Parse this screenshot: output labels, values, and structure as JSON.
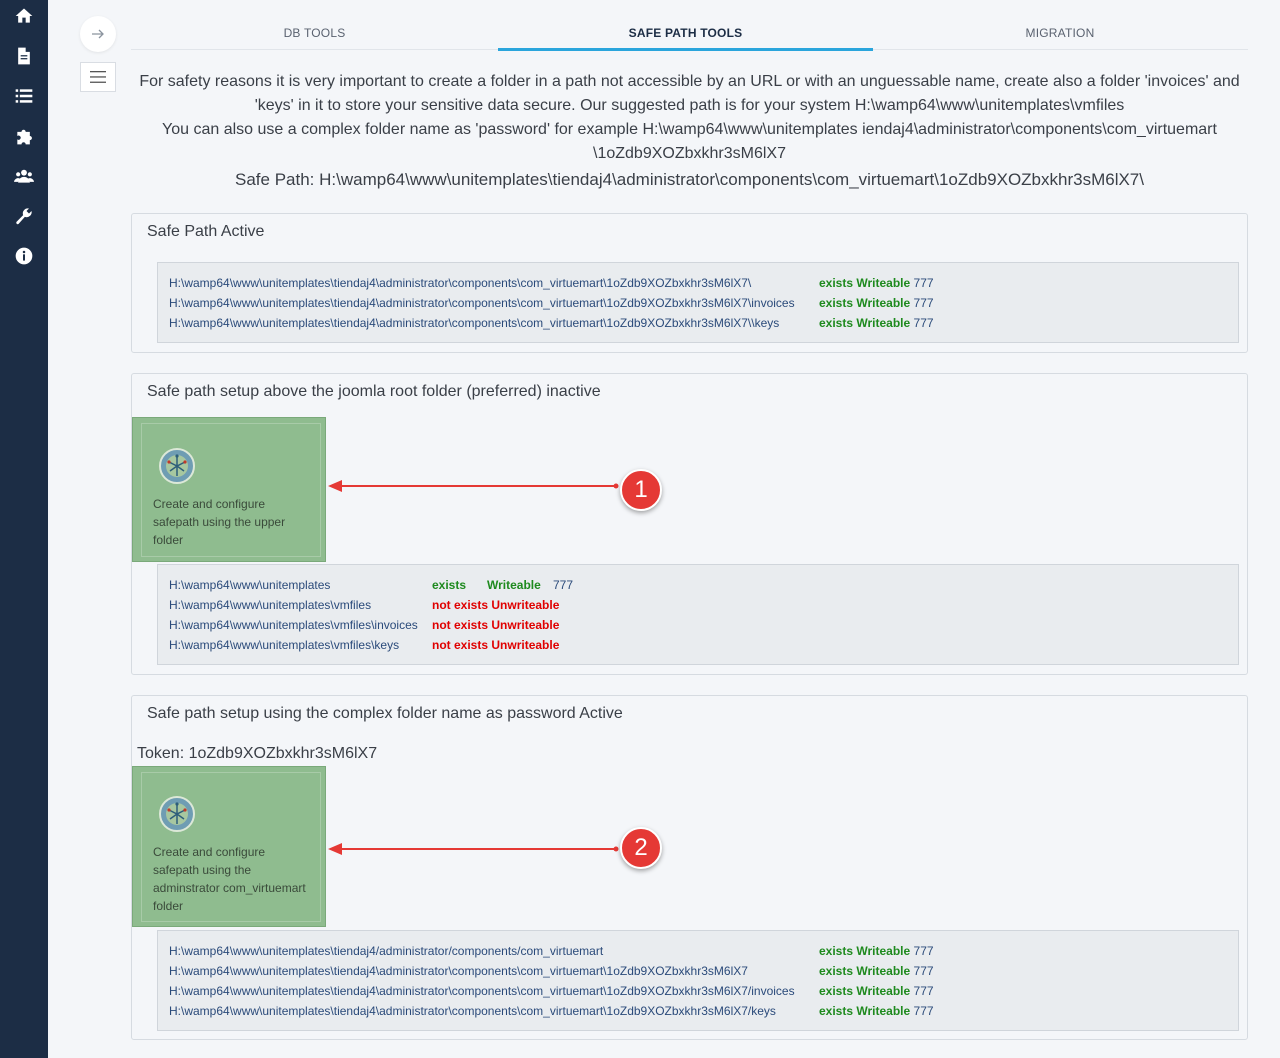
{
  "sidebar": {
    "icons": [
      "home-icon",
      "file-icon",
      "list-icon",
      "puzzle-icon",
      "users-icon",
      "wrench-icon",
      "info-icon"
    ]
  },
  "tabs": [
    {
      "label": "DB TOOLS"
    },
    {
      "label": "SAFE PATH TOOLS"
    },
    {
      "label": "MIGRATION"
    }
  ],
  "intro": {
    "line1": "For safety reasons it is very important to create a folder in a path not accessible by an URL or with an unguessable name, create also a folder 'invoices' and 'keys' in it to store your sensitive data secure. Our suggested path is for your system H:\\wamp64\\www\\unitemplates\\vmfiles",
    "line2": "You can also use a complex folder name as 'password' for example H:\\wamp64\\www\\unitemplates iendaj4\\administrator\\components\\com_virtuemart \\1oZdb9XOZbxkhr3sM6lX7",
    "safe_path": "Safe Path: H:\\wamp64\\www\\unitemplates\\tiendaj4\\administrator\\components\\com_virtuemart\\1oZdb9XOZbxkhr3sM6lX7\\"
  },
  "panel1": {
    "title": "Safe Path Active",
    "rows": [
      {
        "path": "H:\\wamp64\\www\\unitemplates\\tiendaj4\\administrator\\components\\com_virtuemart\\1oZdb9XOZbxkhr3sM6lX7\\",
        "exists": "exists",
        "writeable": "Writeable",
        "perm": "777"
      },
      {
        "path": "H:\\wamp64\\www\\unitemplates\\tiendaj4\\administrator\\components\\com_virtuemart\\1oZdb9XOZbxkhr3sM6lX7\\invoices",
        "exists": "exists",
        "writeable": "Writeable",
        "perm": "777"
      },
      {
        "path": "H:\\wamp64\\www\\unitemplates\\tiendaj4\\administrator\\components\\com_virtuemart\\1oZdb9XOZbxkhr3sM6lX7\\\\keys",
        "exists": "exists",
        "writeable": "Writeable",
        "perm": "777"
      }
    ]
  },
  "panel2": {
    "title": "Safe path setup above the joomla root folder (preferred) inactive",
    "card_text": "Create and configure safepath using the upper folder",
    "callout": "1",
    "rows": [
      {
        "path": "H:\\wamp64\\www\\unitemplates",
        "exists": "exists",
        "writeable": "Writeable",
        "perm": "777"
      },
      {
        "path": "H:\\wamp64\\www\\unitemplates\\vmfiles",
        "exists": "not exists",
        "writeable": "Unwriteable",
        "perm": ""
      },
      {
        "path": "H:\\wamp64\\www\\unitemplates\\vmfiles\\invoices",
        "exists": "not exists",
        "writeable": "Unwriteable",
        "perm": ""
      },
      {
        "path": "H:\\wamp64\\www\\unitemplates\\vmfiles\\keys",
        "exists": "not exists",
        "writeable": "Unwriteable",
        "perm": ""
      }
    ]
  },
  "panel3": {
    "title": "Safe path setup using the complex folder name as password Active",
    "token": "Token: 1oZdb9XOZbxkhr3sM6lX7",
    "card_text": "Create and configure safepath using the adminstrator com_virtuemart folder",
    "callout": "2",
    "rows": [
      {
        "path": "H:\\wamp64\\www\\unitemplates\\tiendaj4/administrator/components/com_virtuemart",
        "exists": "exists",
        "writeable": "Writeable",
        "perm": "777"
      },
      {
        "path": "H:\\wamp64\\www\\unitemplates\\tiendaj4\\administrator\\components\\com_virtuemart\\1oZdb9XOZbxkhr3sM6lX7",
        "exists": "exists",
        "writeable": "Writeable",
        "perm": "777"
      },
      {
        "path": "H:\\wamp64\\www\\unitemplates\\tiendaj4\\administrator\\components\\com_virtuemart\\1oZdb9XOZbxkhr3sM6lX7/invoices",
        "exists": "exists",
        "writeable": "Writeable",
        "perm": "777"
      },
      {
        "path": "H:\\wamp64\\www\\unitemplates\\tiendaj4\\administrator\\components\\com_virtuemart\\1oZdb9XOZbxkhr3sM6lX7/keys",
        "exists": "exists",
        "writeable": "Writeable",
        "perm": "777"
      }
    ]
  },
  "colors": {
    "sidebar": "#1c2d45",
    "accent": "#2aa5dc",
    "ok": "#1e8a1e",
    "bad": "#e00000",
    "card": "#8fbc8f",
    "callout": "#e53935"
  }
}
